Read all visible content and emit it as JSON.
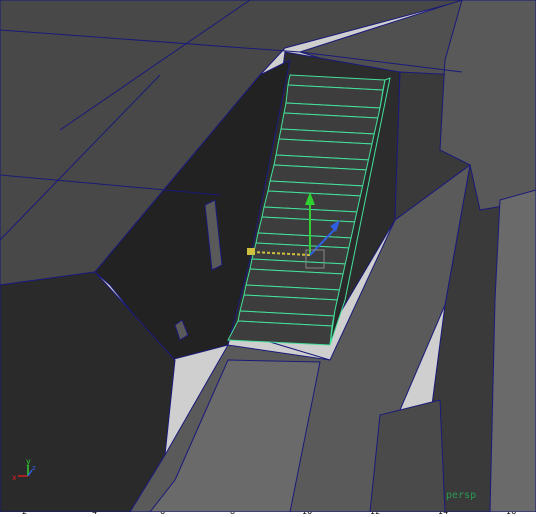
{
  "viewport": {
    "camera_label": "persp",
    "icons": [
      "view-axis-icon",
      "manipulator-icon"
    ],
    "colors": {
      "background": "#cfcfcf",
      "wall_dark": "#2b2b2b",
      "floor_grey": "#4a4a4a",
      "wireframe": "#1a1a7a",
      "selection": "#43e09a",
      "axis_x": "#d02020",
      "axis_y": "#2fd02f",
      "axis_z": "#2f5fe0"
    }
  },
  "ruler": {
    "labels": [
      "2",
      "4",
      "6",
      "8",
      "10",
      "12",
      "14",
      "16"
    ]
  }
}
